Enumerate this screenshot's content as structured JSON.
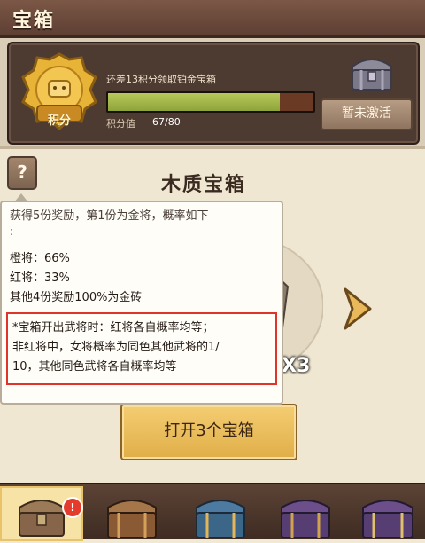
{
  "header": {
    "title": "宝箱"
  },
  "points": {
    "hint": "还差13积分领取铂金宝箱",
    "medal_label": "积分",
    "score_label": "积分值",
    "score_value": "67/80",
    "progress_fraction": 0.8375
  },
  "platinum": {
    "button_label": "暂未激活"
  },
  "chest": {
    "title": "木质宝箱",
    "multiplier": "X3",
    "open_button": "打开3个宝箱"
  },
  "help": {
    "label": "?"
  },
  "tooltip": {
    "cut_line": "获得5份奖励，第1份为金将，概率如下",
    "lines": [
      ":",
      "橙将：66%",
      "红将：33%",
      "其他4份奖励100%为金砖"
    ],
    "rule_lines": [
      "*宝箱开出武将时：红将各自概率均等；",
      "非红将中，女将概率为同色其他武将的1/",
      "10，其他同色武将各自概率均等"
    ]
  },
  "bottom": {
    "badge": "!",
    "slots": [
      "wood-chest",
      "bronze-chest",
      "blue-chest",
      "purple-chest",
      "purple-chest"
    ]
  },
  "colors": {
    "title_bar": "#6a4a3c",
    "highlight_border": "#e0342b",
    "button_gold": "#e8b85a",
    "progress_green": "#9db44a"
  }
}
